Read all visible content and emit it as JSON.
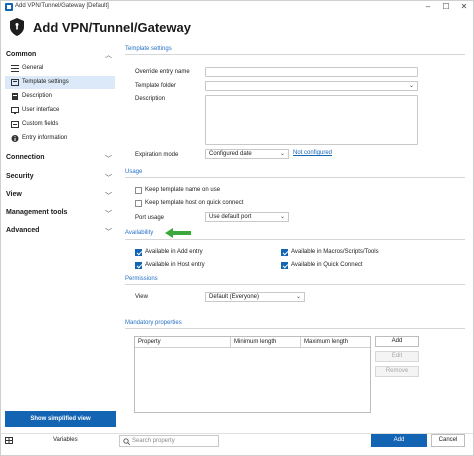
{
  "window": {
    "title": "Add VPN/Tunnel/Gateway [Default]"
  },
  "header": {
    "title": "Add VPN/Tunnel/Gateway"
  },
  "sidebar": {
    "common_label": "Common",
    "items": [
      {
        "label": "General"
      },
      {
        "label": "Template settings"
      },
      {
        "label": "Description"
      },
      {
        "label": "User interface"
      },
      {
        "label": "Custom fields"
      },
      {
        "label": "Entry information"
      }
    ],
    "sections": [
      {
        "label": "Connection"
      },
      {
        "label": "Security"
      },
      {
        "label": "View"
      },
      {
        "label": "Management tools"
      },
      {
        "label": "Advanced"
      }
    ],
    "simplified_button": "Show simplified view"
  },
  "template_settings": {
    "group_title": "Template settings",
    "override_label": "Override entry name",
    "folder_label": "Template folder",
    "description_label": "Description",
    "expiration_label": "Expiration mode",
    "expiration_value": "Configured date",
    "not_configured_link": "Not configured"
  },
  "usage": {
    "group_title": "Usage",
    "keep_name": "Keep template name on use",
    "keep_host": "Keep template host on quick connect",
    "port_label": "Port usage",
    "port_value": "Use default port"
  },
  "availability": {
    "group_title": "Availability",
    "add_entry": "Available in Add entry",
    "host_entry": "Available in Host entry",
    "macros": "Available in Macros/Scripts/Tools",
    "quick_connect": "Available in Quick Connect"
  },
  "permissions": {
    "group_title": "Permissions",
    "view_label": "View",
    "view_value": "Default (Everyone)"
  },
  "mandatory": {
    "group_title": "Mandatory properties",
    "columns": [
      "Property",
      "Minimum length",
      "Maximum length"
    ],
    "add": "Add",
    "edit": "Edit",
    "remove": "Remove"
  },
  "footer": {
    "variables": "Variables",
    "search_placeholder": "Search property",
    "add": "Add",
    "cancel": "Cancel"
  },
  "colors": {
    "accent": "#1464b4",
    "group_title": "#2672c4",
    "arrow": "#3aa83a"
  }
}
